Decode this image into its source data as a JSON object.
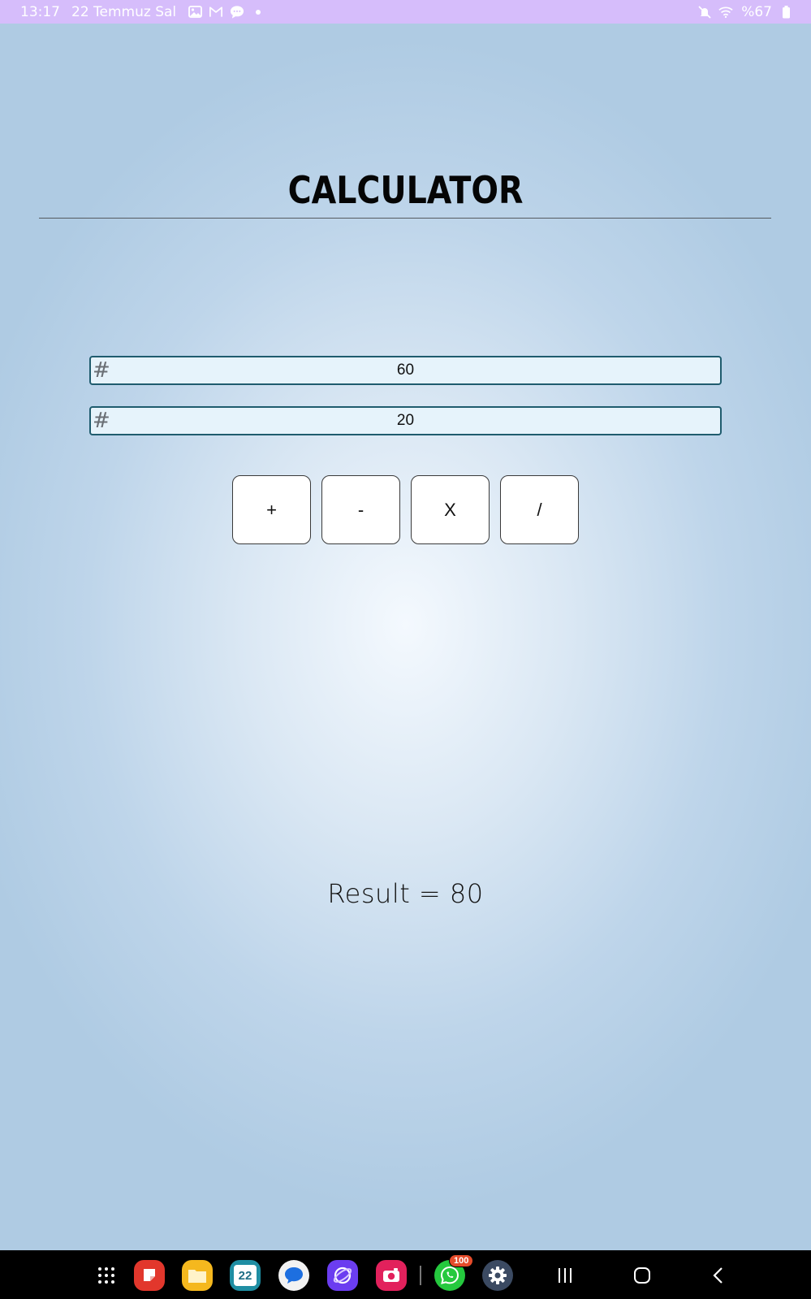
{
  "status_bar": {
    "time": "13:17",
    "date": "22 Temmuz Sal",
    "battery": "%67",
    "left_icons": [
      "gallery-icon",
      "gmail-icon",
      "messages-icon",
      "dot-icon"
    ],
    "right_icons": [
      "mute-icon",
      "wifi-icon",
      "battery-icon"
    ]
  },
  "app": {
    "title": "CALCULATOR",
    "field_a": {
      "value": "60",
      "prefix": "#"
    },
    "field_b": {
      "value": "20",
      "prefix": "#"
    },
    "operators": [
      "+",
      "-",
      "X",
      "/"
    ],
    "result_text": "Result = 80"
  },
  "dock": {
    "calendar_day": "22",
    "whatsapp_badge": "100",
    "apps": [
      "app-drawer-icon",
      "notes-app-icon",
      "files-app-icon",
      "calendar-app-icon",
      "messages-app-icon",
      "browser-app-icon",
      "camera-app-icon",
      "whatsapp-app-icon",
      "settings-app-icon"
    ],
    "nav": [
      "recents-icon",
      "home-icon",
      "back-icon"
    ]
  },
  "colors": {
    "status_bar_bg": "#d6bdfb",
    "field_border": "#1f5c6e",
    "field_bg": "#e6f3fb",
    "background": "#afcbe3"
  }
}
